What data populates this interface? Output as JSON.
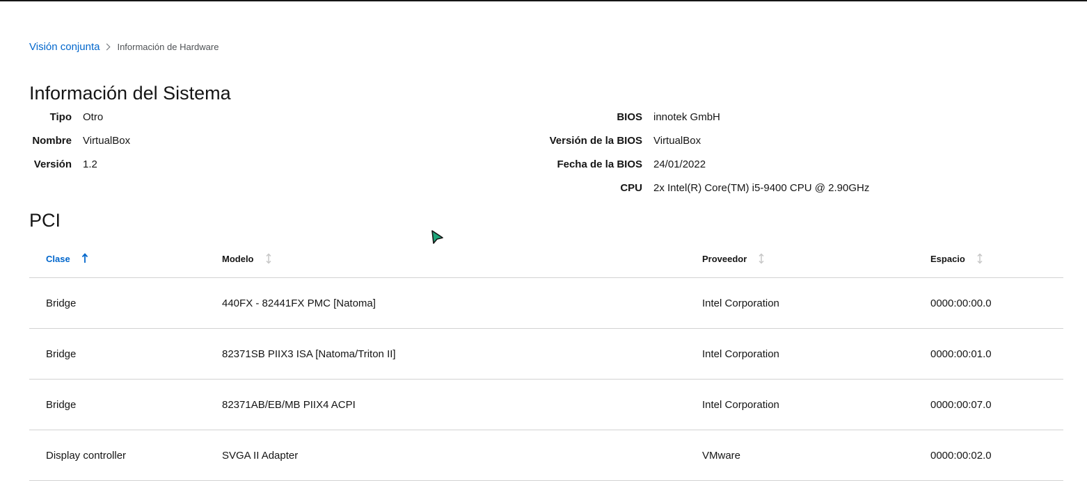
{
  "breadcrumb": {
    "parent": "Visión conjunta",
    "current": "Información de Hardware"
  },
  "system": {
    "title": "Información del Sistema",
    "left": [
      {
        "term": "Tipo",
        "value": "Otro"
      },
      {
        "term": "Nombre",
        "value": "VirtualBox"
      },
      {
        "term": "Versión",
        "value": "1.2"
      }
    ],
    "right": [
      {
        "term": "BIOS",
        "value": "innotek GmbH"
      },
      {
        "term": "Versión de la BIOS",
        "value": "VirtualBox"
      },
      {
        "term": "Fecha de la BIOS",
        "value": "24/01/2022"
      },
      {
        "term": "CPU",
        "value": "2x Intel(R) Core(TM) i5-9400 CPU @ 2.90GHz"
      }
    ]
  },
  "pci": {
    "title": "PCI",
    "columns": [
      "Clase",
      "Modelo",
      "Proveedor",
      "Espacio"
    ],
    "sorted_column": "Clase",
    "sort_direction": "ascending",
    "rows": [
      [
        "Bridge",
        "440FX - 82441FX PMC [Natoma]",
        "Intel Corporation",
        "0000:00:00.0"
      ],
      [
        "Bridge",
        "82371SB PIIX3 ISA [Natoma/Triton II]",
        "Intel Corporation",
        "0000:00:01.0"
      ],
      [
        "Bridge",
        "82371AB/EB/MB PIIX4 ACPI",
        "Intel Corporation",
        "0000:00:07.0"
      ],
      [
        "Display controller",
        "SVGA II Adapter",
        "VMware",
        "0000:00:02.0"
      ]
    ]
  },
  "colors": {
    "link": "#0066cc",
    "text": "#151515",
    "muted": "#6a6e73",
    "border": "#d2d2d2",
    "cursor_fill": "#1fa67a"
  }
}
